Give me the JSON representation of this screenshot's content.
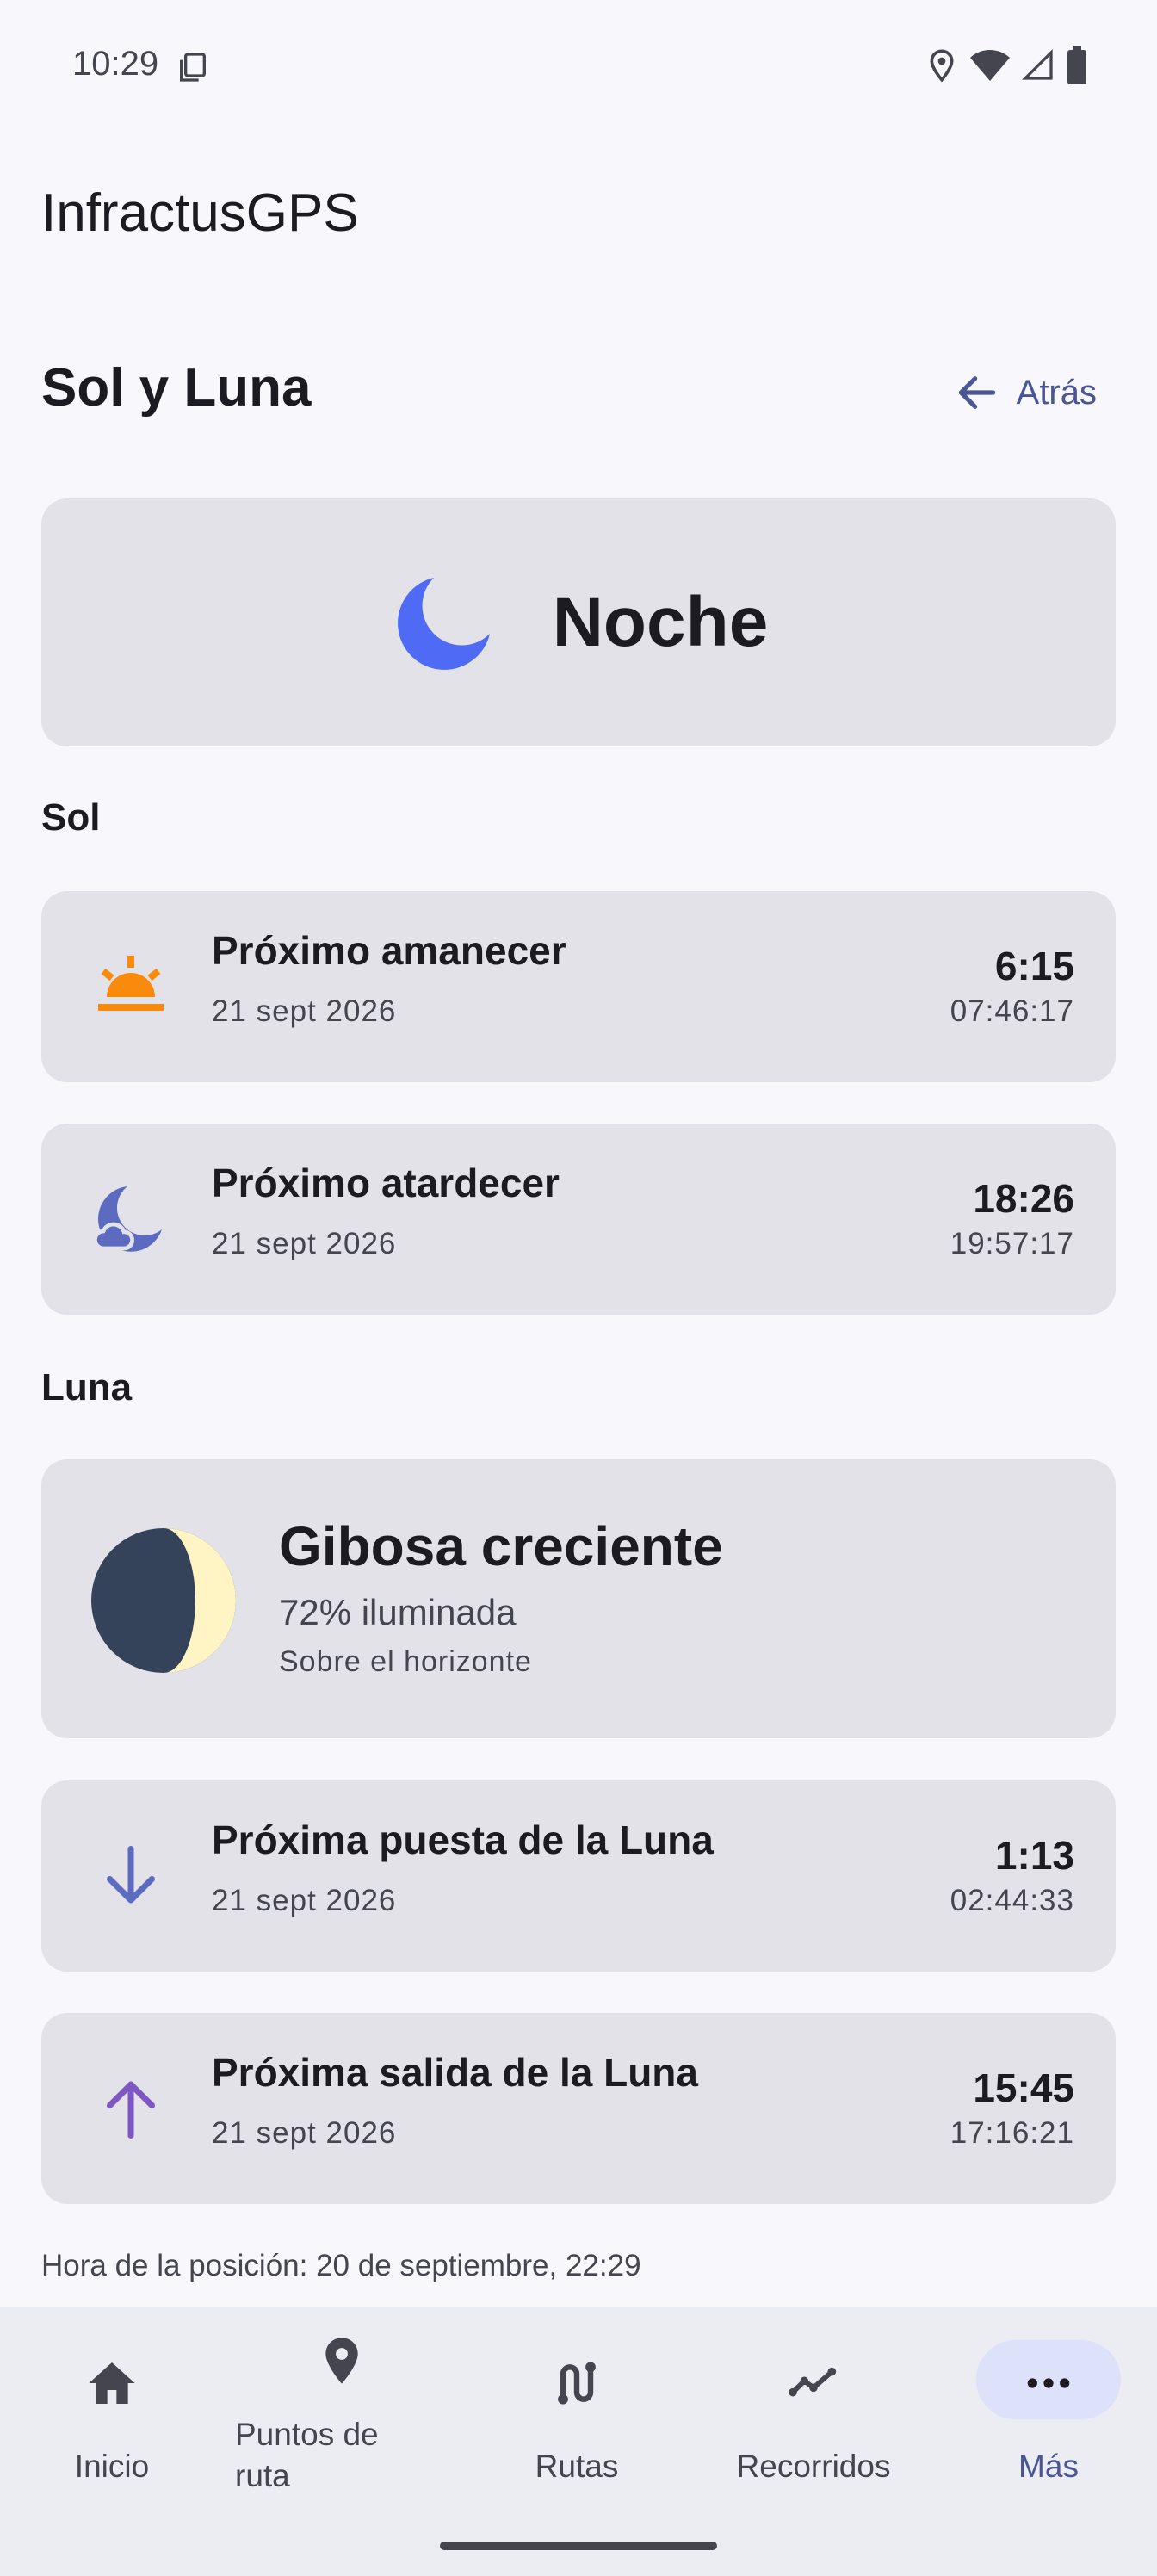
{
  "status_bar": {
    "time": "10:29"
  },
  "app": {
    "title": "InfractusGPS"
  },
  "header": {
    "title": "Sol y Luna",
    "back_label": "Atrás"
  },
  "hero": {
    "state": "Noche",
    "icon": "moon-icon",
    "icon_color": "#4f6bf5"
  },
  "sun": {
    "section_label": "Sol",
    "sunrise": {
      "title": "Próximo amanecer",
      "date": "21 sept 2026",
      "time": "6:15",
      "exact": "07:46:17",
      "icon": "sunrise-icon",
      "icon_color": "#fa8a0c"
    },
    "sunset": {
      "title": "Próximo atardecer",
      "date": "21 sept 2026",
      "time": "18:26",
      "exact": "19:57:17",
      "icon": "night-cloud-icon",
      "icon_color": "#5c6bc0"
    }
  },
  "moon": {
    "section_label": "Luna",
    "phase": "Gibosa creciente",
    "illumination": "72% iluminada",
    "horizon": "Sobre el horizonte",
    "illumination_fraction": 0.72,
    "moonset": {
      "title": "Próxima puesta de la Luna",
      "date": "21 sept 2026",
      "time": "1:13",
      "exact": "02:44:33",
      "icon": "arrow-down-icon",
      "icon_color": "#5c6bc0"
    },
    "moonrise": {
      "title": "Próxima salida de la Luna",
      "date": "21 sept 2026",
      "time": "15:45",
      "exact": "17:16:21",
      "icon": "arrow-up-icon",
      "icon_color": "#7e57c2"
    }
  },
  "footnote": "Hora de la posición: 20 de septiembre, 22:29",
  "nav": {
    "items": [
      {
        "label": "Inicio",
        "icon": "home-icon"
      },
      {
        "label": "Puntos de ruta",
        "icon": "location-pin-icon"
      },
      {
        "label": "Rutas",
        "icon": "route-icon"
      },
      {
        "label": "Recorridos",
        "icon": "chart-line-icon"
      },
      {
        "label": "Más",
        "icon": "more-horizontal-icon",
        "selected": true
      }
    ],
    "accent": "#4a5596"
  }
}
